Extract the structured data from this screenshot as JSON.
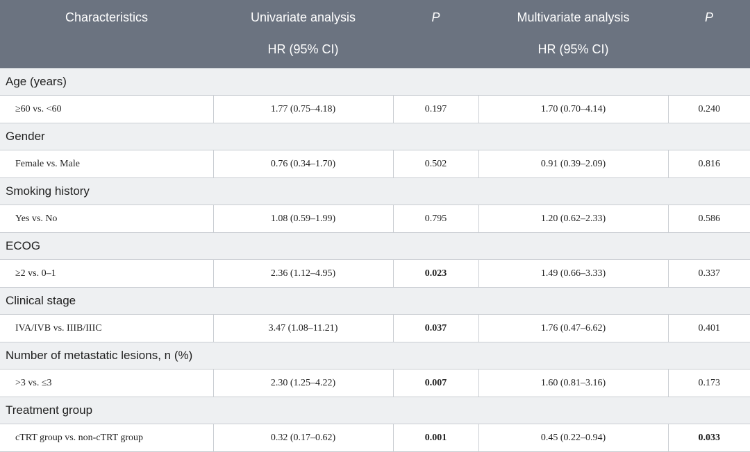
{
  "header": {
    "row1": [
      "Characteristics",
      "Univariate analysis",
      "P",
      "Multivariate analysis",
      "P"
    ],
    "row2": [
      "",
      "HR (95% CI)",
      "",
      "HR (95% CI)",
      ""
    ]
  },
  "groups": [
    {
      "title": "Age (years)",
      "row": {
        "label": "≥60 vs. <60",
        "uni_hr": "1.77 (0.75–4.18)",
        "uni_p": "0.197",
        "uni_p_bold": false,
        "multi_hr": "1.70 (0.70–4.14)",
        "multi_p": "0.240",
        "multi_p_bold": false
      }
    },
    {
      "title": "Gender",
      "row": {
        "label": "Female vs. Male",
        "uni_hr": "0.76 (0.34–1.70)",
        "uni_p": "0.502",
        "uni_p_bold": false,
        "multi_hr": "0.91 (0.39–2.09)",
        "multi_p": "0.816",
        "multi_p_bold": false
      }
    },
    {
      "title": "Smoking history",
      "row": {
        "label": "Yes vs. No",
        "uni_hr": "1.08 (0.59–1.99)",
        "uni_p": "0.795",
        "uni_p_bold": false,
        "multi_hr": "1.20 (0.62–2.33)",
        "multi_p": "0.586",
        "multi_p_bold": false
      }
    },
    {
      "title": "ECOG",
      "row": {
        "label": "≥2 vs. 0–1",
        "uni_hr": "2.36 (1.12–4.95)",
        "uni_p": "0.023",
        "uni_p_bold": true,
        "multi_hr": "1.49 (0.66–3.33)",
        "multi_p": "0.337",
        "multi_p_bold": false
      }
    },
    {
      "title": "Clinical stage",
      "row": {
        "label": "IVA/IVB vs. IIIB/IIIC",
        "uni_hr": "3.47 (1.08–11.21)",
        "uni_p": "0.037",
        "uni_p_bold": true,
        "multi_hr": "1.76 (0.47–6.62)",
        "multi_p": "0.401",
        "multi_p_bold": false
      }
    },
    {
      "title": "Number of metastatic lesions, n (%)",
      "row": {
        "label": ">3 vs. ≤3",
        "uni_hr": "2.30 (1.25–4.22)",
        "uni_p": "0.007",
        "uni_p_bold": true,
        "multi_hr": "1.60 (0.81–3.16)",
        "multi_p": "0.173",
        "multi_p_bold": false
      }
    },
    {
      "title": "Treatment group",
      "row": {
        "label": "cTRT group vs. non-cTRT group",
        "uni_hr": "0.32 (0.17–0.62)",
        "uni_p": "0.001",
        "uni_p_bold": true,
        "multi_hr": "0.45 (0.22–0.94)",
        "multi_p": "0.033",
        "multi_p_bold": true
      }
    }
  ]
}
